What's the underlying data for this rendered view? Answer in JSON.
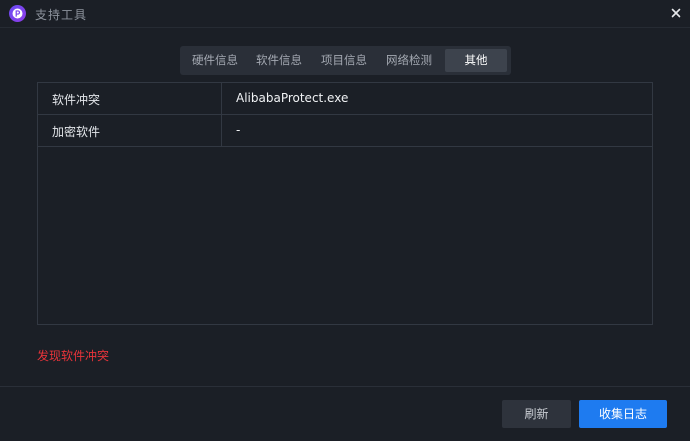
{
  "window": {
    "title": "支持工具",
    "icons": {
      "logo": "app-logo-icon",
      "close": "close-icon"
    }
  },
  "tabs": [
    {
      "label": "硬件信息",
      "active": false
    },
    {
      "label": "软件信息",
      "active": false
    },
    {
      "label": "项目信息",
      "active": false
    },
    {
      "label": "网络检测",
      "active": false
    },
    {
      "label": "其他",
      "active": true
    }
  ],
  "table": {
    "rows": [
      {
        "key": "软件冲突",
        "value": "AlibabaProtect.exe"
      },
      {
        "key": "加密软件",
        "value": "-"
      }
    ]
  },
  "status": {
    "message": "发现软件冲突",
    "color": "#e8343a"
  },
  "footer": {
    "refresh_label": "刷新",
    "collect_label": "收集日志",
    "accent": "#1e7bf0"
  }
}
